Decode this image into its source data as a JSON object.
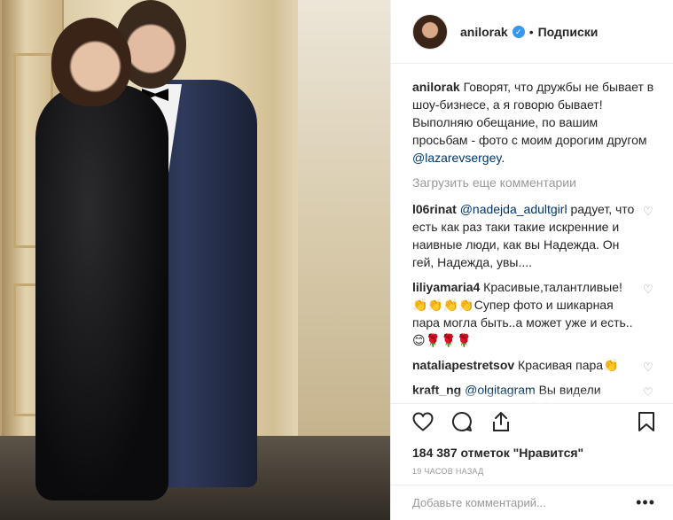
{
  "header": {
    "username": "anilorak",
    "verified_glyph": "✓",
    "separator": "•",
    "follow_label": "Подписки"
  },
  "caption": {
    "username": "anilorak",
    "text": "Говорят, что дружбы не бывает в шоу-бизнесе, а я говорю бывает! Выполняю обещание, по вашим просьбам - фото с моим дорогим другом ",
    "mention": "@lazarevsergey",
    "end": "."
  },
  "load_more_label": "Загрузить еще комментарии",
  "comments": [
    {
      "username": "l06rinat",
      "mention": "@nadejda_adultgirl",
      "text": " радует, что есть как раз таки такие искренние и наивные люди, как вы Надежда. Он гей, Надежда, увы...."
    },
    {
      "username": "liliyamaria4",
      "mention": "",
      "text": " Красивые,талантливые! 👏👏👏👏Супер фото и шикарная пара могла быть..а может уже и есть..😊🌹🌹🌹"
    },
    {
      "username": "nataliapestretsov",
      "mention": "",
      "text": " Красивая пара👏"
    },
    {
      "username": "kraft_ng",
      "mention": "@olgitagram",
      "text": " Вы видели торнадо в океане??😱😱это ужасно красиво😵😵 Мы хотим вам показать @lifeocean_tv"
    }
  ],
  "likes": {
    "text": "184 387 отметок \"Нравится\""
  },
  "timestamp": "19 ЧАСОВ НАЗАД",
  "add_comment": {
    "placeholder": "Добавьте комментарий...",
    "more_glyph": "•••"
  },
  "icons": {
    "like": "heart-icon",
    "comment": "comment-icon",
    "share": "share-icon",
    "save": "bookmark-icon",
    "comment_like": "small-heart-icon"
  },
  "colors": {
    "verified": "#3897f0",
    "mention": "#003569",
    "muted": "#999999",
    "text": "#262626"
  }
}
